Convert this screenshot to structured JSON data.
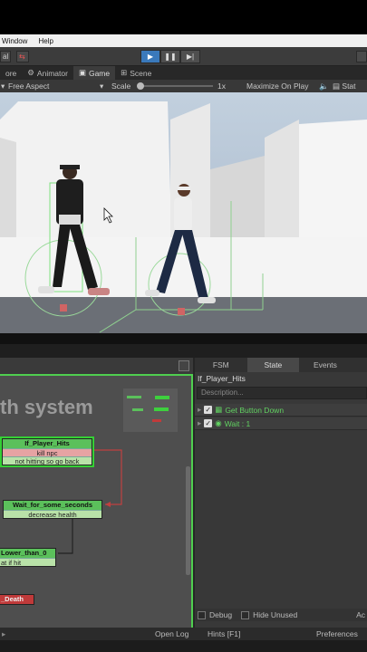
{
  "menubar": {
    "items": [
      "Window",
      "Help"
    ]
  },
  "toolbar": {
    "left_label": "al",
    "play_icon": "play-icon",
    "pause_icon": "pause-icon",
    "step_icon": "step-icon"
  },
  "tabs": [
    {
      "label": "ore"
    },
    {
      "label": "Animator",
      "icon": "animator-icon"
    },
    {
      "label": "Game",
      "icon": "game-icon"
    },
    {
      "label": "Scene",
      "icon": "scene-icon"
    }
  ],
  "gamebar": {
    "aspect": "Free Aspect",
    "scale_label": "Scale",
    "scale_value": "1x",
    "maximize": "Maximize On Play",
    "stats": "Stat"
  },
  "fsm": {
    "title": "th system",
    "states": [
      {
        "name": "If_Player_Hits",
        "rows": [
          "kill npc",
          "not hitting so go back"
        ]
      },
      {
        "name": "Wait_for_some_seconds",
        "rows": [
          "decrease health"
        ]
      },
      {
        "name": "Lower_than_0",
        "rows": [
          "at if hit"
        ]
      },
      {
        "name": "_Death",
        "rows": []
      }
    ]
  },
  "inspector": {
    "tabs": [
      "FSM",
      "State",
      "Events",
      ""
    ],
    "state_name": "If_Player_Hits",
    "description_placeholder": "Description...",
    "actions": [
      "Get Button Down",
      "Wait : 1"
    ],
    "debug_label": "Debug",
    "hide_unused_label": "Hide Unused",
    "action_button": "Ac"
  },
  "statusbar": {
    "open_log": "Open Log",
    "hints": "Hints [F1]",
    "preferences": "Preferences"
  },
  "colors": {
    "accent_green": "#4fcf4f",
    "play_blue": "#3a79bb",
    "death_red": "#c03a3a"
  }
}
